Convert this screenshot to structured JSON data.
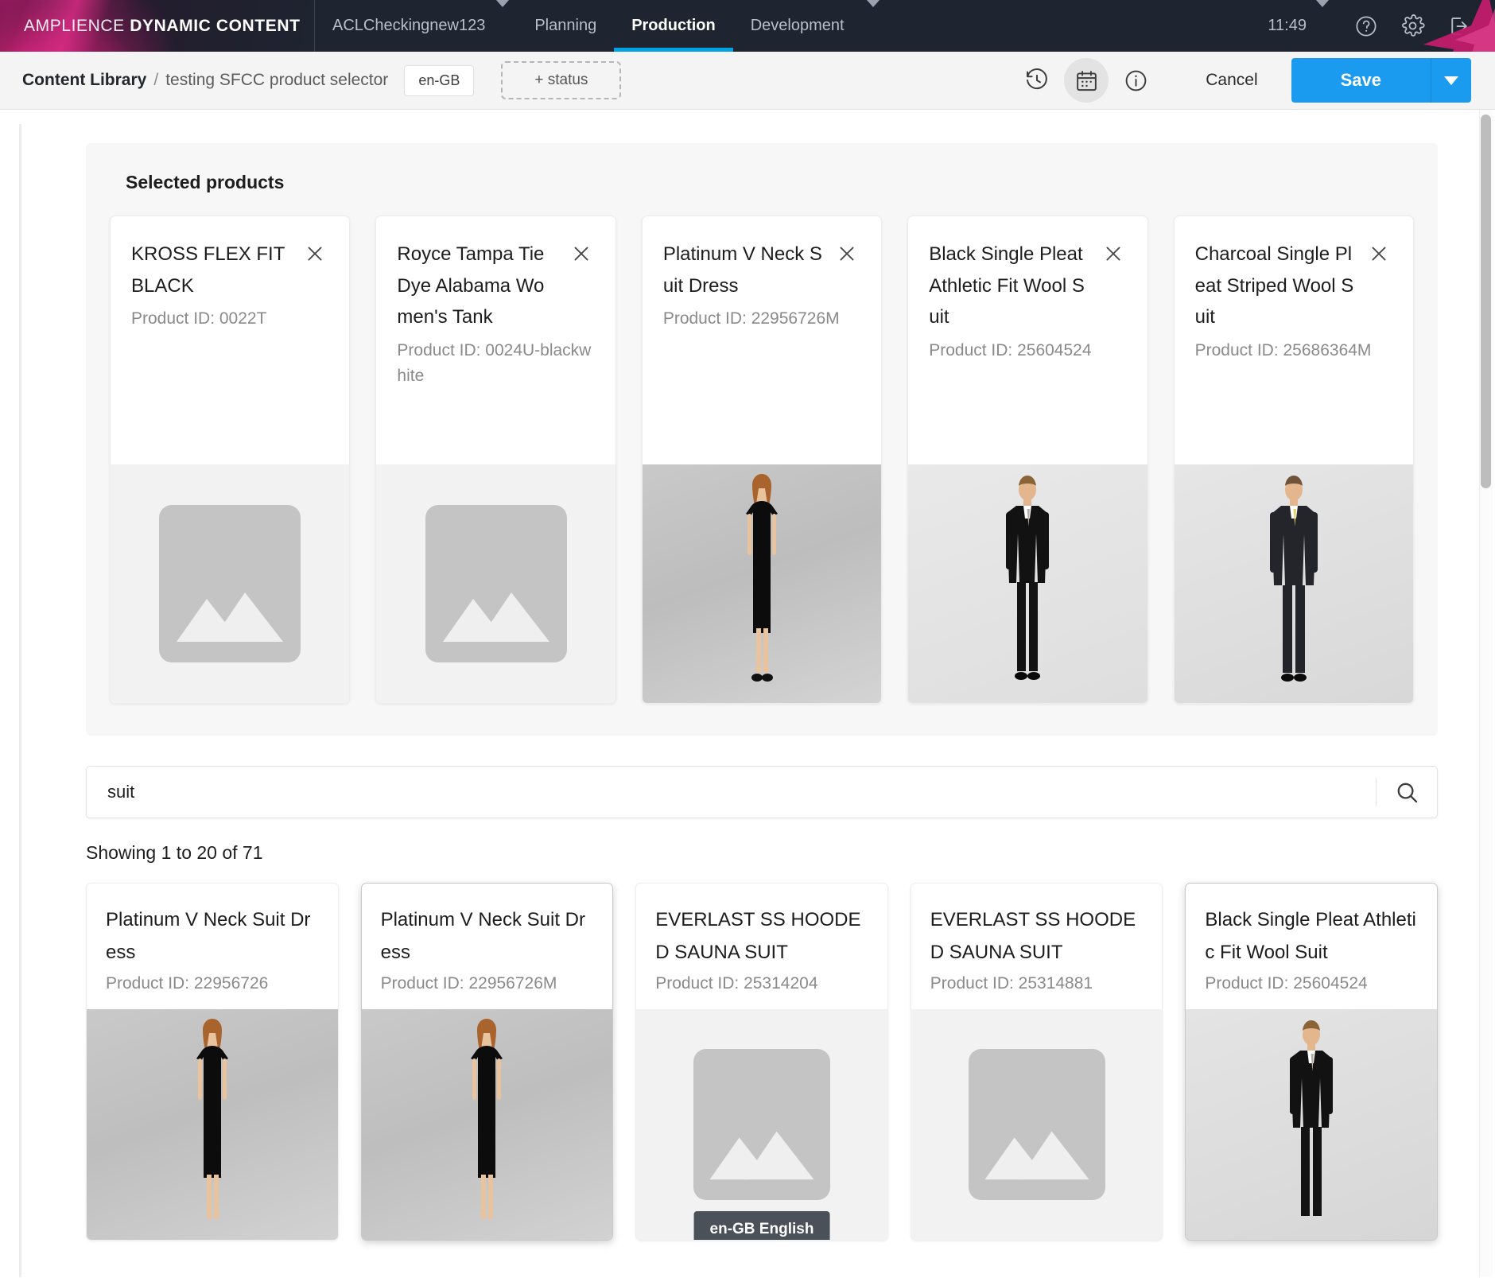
{
  "topnav": {
    "logo_light": "AMPLIENCE",
    "logo_bold": "DYNAMIC CONTENT",
    "account": "ACLCheckingnew123",
    "items": [
      {
        "label": "Planning",
        "active": false
      },
      {
        "label": "Production",
        "active": true
      },
      {
        "label": "Development",
        "active": false
      }
    ],
    "time": "11:49",
    "icons": [
      "help-icon",
      "gear-icon",
      "logout-icon"
    ]
  },
  "subheader": {
    "breadcrumb_root": "Content Library",
    "breadcrumb_sep": "/",
    "breadcrumb_current": "testing SFCC product selector",
    "locale_chip": "en-GB",
    "status_chip": "+ status",
    "icons": [
      "history-icon",
      "calendar-icon",
      "info-icon"
    ],
    "cancel_label": "Cancel",
    "save_label": "Save",
    "accent_color": "#1b9bef"
  },
  "selected": {
    "title": "Selected products",
    "products": [
      {
        "name": "KROSS FLEX FIT BLACK",
        "pid": "Product ID: 0022T",
        "image": "placeholder"
      },
      {
        "name": "Royce Tampa Tie Dye Alabama Women's Tank",
        "pid": "Product ID: 0024U-blackwhite",
        "image": "placeholder"
      },
      {
        "name": "Platinum V Neck Suit Dress",
        "pid": "Product ID: 22956726M",
        "image": "woman-black-dress"
      },
      {
        "name": "Black Single Pleat Athletic Fit Wool Suit",
        "pid": "Product ID: 25604524",
        "image": "man-black-suit"
      },
      {
        "name": "Charcoal Single Pleat Striped Wool Suit",
        "pid": "Product ID: 25686364M",
        "image": "man-charcoal-suit"
      }
    ]
  },
  "search": {
    "value": "suit",
    "placeholder": "Search",
    "icon": "search-icon"
  },
  "results": {
    "showing": "Showing 1 to 20 of 71",
    "items": [
      {
        "name": "Platinum V Neck Suit Dress",
        "pid": "Product ID: 22956726",
        "image": "woman-black-dress",
        "hover": false,
        "tooltip": ""
      },
      {
        "name": "Platinum V Neck Suit Dress",
        "pid": "Product ID: 22956726M",
        "image": "woman-black-dress",
        "hover": true,
        "tooltip": ""
      },
      {
        "name": "EVERLAST SS HOODED SAUNA SUIT",
        "pid": "Product ID: 25314204",
        "image": "placeholder",
        "hover": false,
        "tooltip": "en-GB English"
      },
      {
        "name": "EVERLAST SS HOODED SAUNA SUIT",
        "pid": "Product ID: 25314881",
        "image": "placeholder",
        "hover": false,
        "tooltip": ""
      },
      {
        "name": "Black Single Pleat Athletic Fit Wool Suit",
        "pid": "Product ID: 25604524",
        "image": "man-black-suit",
        "hover": true,
        "tooltip": ""
      }
    ]
  }
}
